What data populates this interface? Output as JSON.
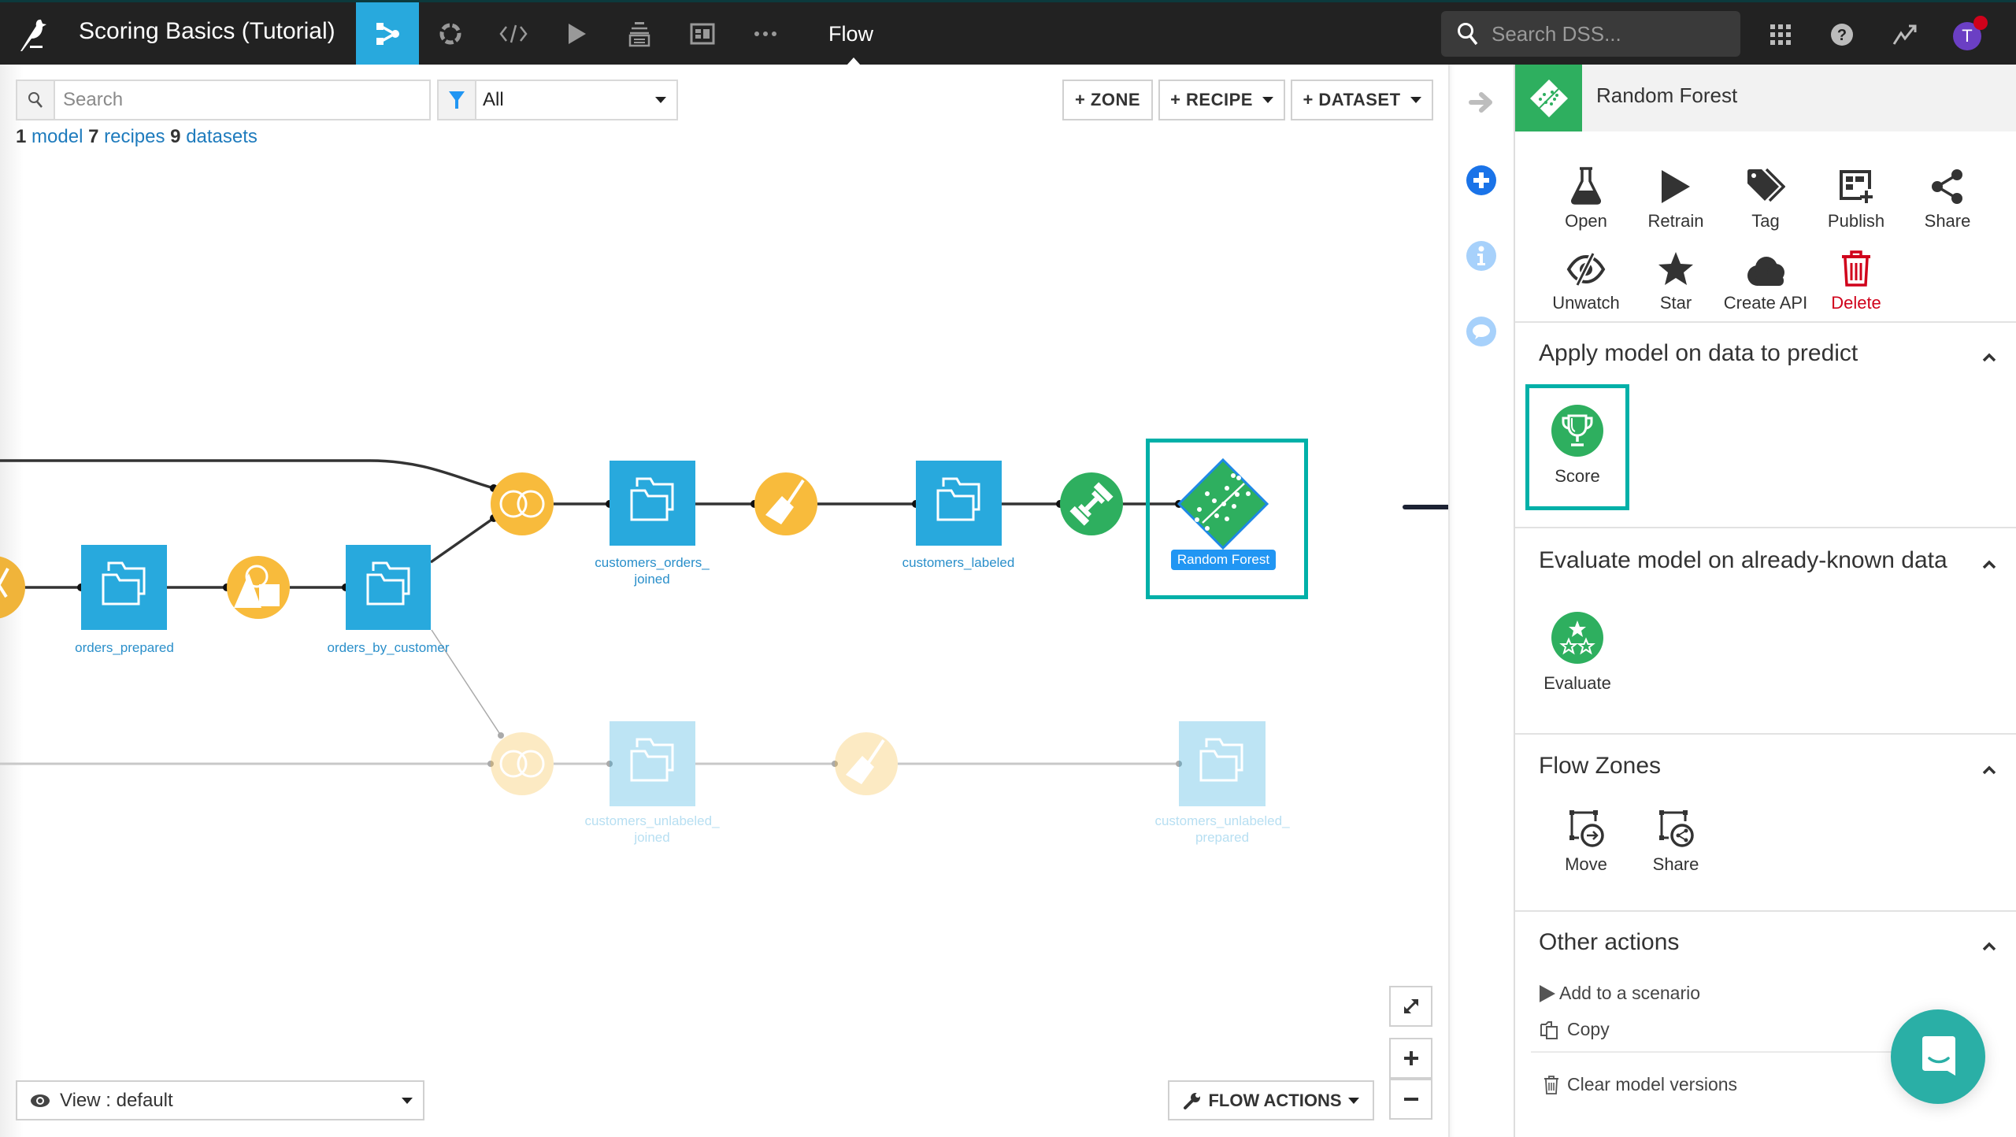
{
  "topbar": {
    "project_title": "Scoring Basics (Tutorial)",
    "nav_items": [
      {
        "name": "flow",
        "icon": "flow-icon",
        "active": true
      },
      {
        "name": "lab",
        "icon": "lab-circle-icon"
      },
      {
        "name": "code",
        "icon": "code-icon"
      },
      {
        "name": "jobs",
        "icon": "play-icon"
      },
      {
        "name": "wiki",
        "icon": "stack-icon"
      },
      {
        "name": "dashboards",
        "icon": "dashboard-icon"
      },
      {
        "name": "more",
        "icon": "more-icon"
      }
    ],
    "section_name": "Flow",
    "search_placeholder": "Search DSS...",
    "avatar_initial": "T",
    "colors": {
      "bar": "#222222",
      "active_nav": "#28a9dd",
      "avatar": "#6b3fc4",
      "notification": "#d0021b"
    }
  },
  "flow": {
    "search_placeholder": "Search",
    "filter_value": "All",
    "stats": [
      {
        "count": "1",
        "label": "model"
      },
      {
        "count": "7",
        "label": "recipes"
      },
      {
        "count": "9",
        "label": "datasets"
      }
    ],
    "toolbar": {
      "zone_label": "+ ZONE",
      "recipe_label": "+ RECIPE",
      "dataset_label": "+ DATASET"
    },
    "datasets": [
      {
        "id": "orders_prepared",
        "label": "orders_prepared",
        "faded": false
      },
      {
        "id": "orders_by_customer",
        "label": "orders_by_customer",
        "faded": false
      },
      {
        "id": "customers_orders_joined",
        "label": "customers_orders_\njoined",
        "faded": false
      },
      {
        "id": "customers_labeled",
        "label": "customers_labeled",
        "faded": false
      },
      {
        "id": "customers_unlabeled_joined",
        "label": "customers_unlabeled_\njoined",
        "faded": true
      },
      {
        "id": "customers_unlabeled_prepared",
        "label": "customers_unlabeled_\nprepared",
        "faded": true
      }
    ],
    "recipes": [
      {
        "id": "prepare_left",
        "type": "prepare",
        "faded": false
      },
      {
        "id": "group",
        "type": "group",
        "faded": false
      },
      {
        "id": "join_top",
        "type": "join",
        "faded": false
      },
      {
        "id": "prepare_top",
        "type": "prepare",
        "faded": false
      },
      {
        "id": "train",
        "type": "train",
        "faded": false
      },
      {
        "id": "join_bottom",
        "type": "join",
        "faded": true
      },
      {
        "id": "prepare_bottom",
        "type": "prepare",
        "faded": true
      }
    ],
    "model": {
      "label": "Random Forest",
      "selected": true
    },
    "view_label": "View : default",
    "flow_actions_label": "FLOW ACTIONS",
    "colors": {
      "dataset": "#28a9dd",
      "recipe": "#f8bb3c",
      "ml": "#2eaf5f",
      "selection": "#00b0a8",
      "model_badge": "#2196f3"
    }
  },
  "side_strip": {
    "icons": [
      "arrow-right-icon",
      "plus-circle-icon",
      "info-icon",
      "comment-icon"
    ]
  },
  "panel": {
    "title": "Random Forest",
    "actions_row1": [
      {
        "label": "Open",
        "icon": "flask-icon"
      },
      {
        "label": "Retrain",
        "icon": "play-icon"
      },
      {
        "label": "Tag",
        "icon": "tags-icon"
      },
      {
        "label": "Publish",
        "icon": "publish-icon"
      },
      {
        "label": "Share",
        "icon": "share-icon"
      }
    ],
    "actions_row2": [
      {
        "label": "Unwatch",
        "icon": "eye-slash-icon"
      },
      {
        "label": "Star",
        "icon": "star-icon"
      },
      {
        "label": "Create API",
        "icon": "cloud-icon"
      },
      {
        "label": "Delete",
        "icon": "trash-icon",
        "danger": true
      }
    ],
    "sections": {
      "apply": {
        "title": "Apply model on data to predict",
        "items": [
          {
            "label": "Score",
            "icon": "trophy-icon",
            "highlighted": true
          }
        ]
      },
      "evaluate": {
        "title": "Evaluate model on already-known data",
        "items": [
          {
            "label": "Evaluate",
            "icon": "stars-icon"
          }
        ]
      },
      "zones": {
        "title": "Flow Zones",
        "items": [
          {
            "label": "Move",
            "icon": "zone-move-icon"
          },
          {
            "label": "Share",
            "icon": "zone-share-icon"
          }
        ]
      },
      "other": {
        "title": "Other actions",
        "items": [
          {
            "label": "Add to a scenario",
            "icon": "play-icon"
          },
          {
            "label": "Copy",
            "icon": "copy-icon"
          },
          {
            "label": "Clear model versions",
            "icon": "trash-icon"
          }
        ]
      }
    },
    "colors": {
      "header_icon": "#2eaf5f",
      "danger": "#d0021b",
      "chat": "#2aafa6"
    }
  }
}
